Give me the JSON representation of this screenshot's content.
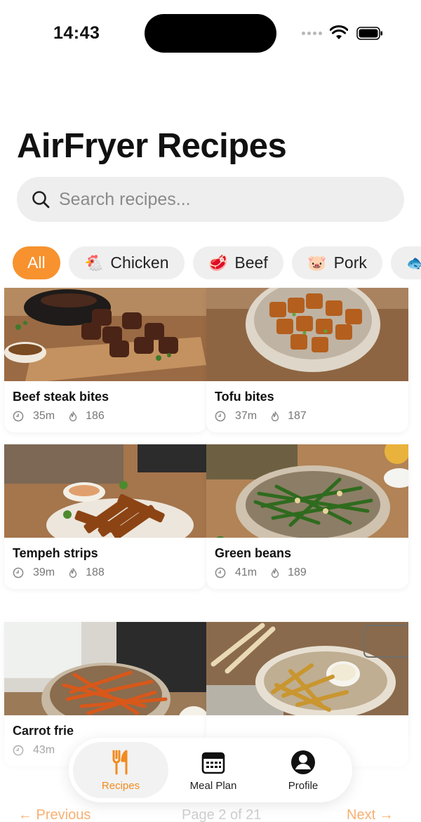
{
  "status_bar": {
    "time": "14:43"
  },
  "header": {
    "title": "AirFryer Recipes"
  },
  "search": {
    "placeholder": "Search recipes..."
  },
  "categories": [
    {
      "label": "All",
      "icon": "",
      "active": true
    },
    {
      "label": "Chicken",
      "icon": "🐔"
    },
    {
      "label": "Beef",
      "icon": "🥩"
    },
    {
      "label": "Pork",
      "icon": "🐷"
    },
    {
      "label": "",
      "icon": "🐟"
    }
  ],
  "recipes": [
    {
      "name": "Beef steak bites",
      "time": "35m",
      "calories": "186",
      "image": "steak-bites-photo"
    },
    {
      "name": "Tofu bites",
      "time": "37m",
      "calories": "187",
      "image": "tofu-bites-photo"
    },
    {
      "name": "Tempeh strips",
      "time": "39m",
      "calories": "188",
      "image": "tempeh-strips-photo"
    },
    {
      "name": "Green beans",
      "time": "41m",
      "calories": "189",
      "image": "green-beans-photo"
    },
    {
      "name": "Carrot frie",
      "time": "43m",
      "calories": "",
      "image": "carrot-fries-photo"
    },
    {
      "name": "",
      "time": "",
      "calories": "",
      "image": "parsnip-fries-photo"
    }
  ],
  "bottom_nav": {
    "recipes": "Recipes",
    "meal_plan": "Meal Plan",
    "profile": "Profile"
  },
  "pagination": {
    "previous": "← Previous",
    "page": "Page 2 of 21",
    "next": "Next →"
  },
  "colors": {
    "accent": "#f7922f",
    "chip_bg": "#efefef",
    "search_bg": "#eeeeee"
  }
}
